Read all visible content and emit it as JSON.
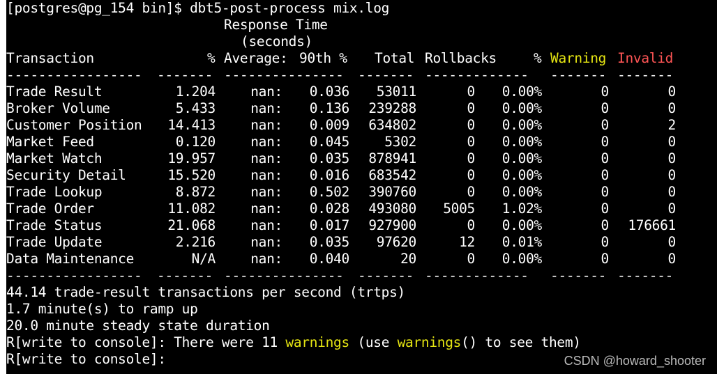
{
  "prompt_command": "[postgres@pg_154 bin]$ dbt5-post-process mix.log",
  "header": {
    "response_time": "Response Time",
    "seconds": "(seconds)",
    "col_transaction": "Transaction",
    "col_pct": "%",
    "col_average": "Average:",
    "col_90th": "90th %",
    "col_total": "Total",
    "col_rollbacks": "Rollbacks",
    "col_rb_pct": "%",
    "col_warning": "Warning",
    "col_invalid": "Invalid"
  },
  "separator": {
    "s1": "-----------------",
    "s2": "-------",
    "s3": "---------------",
    "s4": "-------",
    "s5": "-------------",
    "s6": "-------",
    "s7": "-------"
  },
  "rows": [
    {
      "name": "Trade Result",
      "pct": "1.204",
      "avg": "nan:",
      "p90": "0.036",
      "total": "53011",
      "rollbacks": "0",
      "rb_pct": "0.00%",
      "warning": "0",
      "invalid": "0"
    },
    {
      "name": "Broker Volume",
      "pct": "5.433",
      "avg": "nan:",
      "p90": "0.136",
      "total": "239288",
      "rollbacks": "0",
      "rb_pct": "0.00%",
      "warning": "0",
      "invalid": "0"
    },
    {
      "name": "Customer Position",
      "pct": "14.413",
      "avg": "nan:",
      "p90": "0.009",
      "total": "634802",
      "rollbacks": "0",
      "rb_pct": "0.00%",
      "warning": "0",
      "invalid": "2"
    },
    {
      "name": "Market Feed",
      "pct": "0.120",
      "avg": "nan:",
      "p90": "0.045",
      "total": "5302",
      "rollbacks": "0",
      "rb_pct": "0.00%",
      "warning": "0",
      "invalid": "0"
    },
    {
      "name": "Market Watch",
      "pct": "19.957",
      "avg": "nan:",
      "p90": "0.035",
      "total": "878941",
      "rollbacks": "0",
      "rb_pct": "0.00%",
      "warning": "0",
      "invalid": "0"
    },
    {
      "name": "Security Detail",
      "pct": "15.520",
      "avg": "nan:",
      "p90": "0.016",
      "total": "683542",
      "rollbacks": "0",
      "rb_pct": "0.00%",
      "warning": "0",
      "invalid": "0"
    },
    {
      "name": "Trade Lookup",
      "pct": "8.872",
      "avg": "nan:",
      "p90": "0.502",
      "total": "390760",
      "rollbacks": "0",
      "rb_pct": "0.00%",
      "warning": "0",
      "invalid": "0"
    },
    {
      "name": "Trade Order",
      "pct": "11.082",
      "avg": "nan:",
      "p90": "0.028",
      "total": "493080",
      "rollbacks": "5005",
      "rb_pct": "1.02%",
      "warning": "0",
      "invalid": "0"
    },
    {
      "name": "Trade Status",
      "pct": "21.068",
      "avg": "nan:",
      "p90": "0.017",
      "total": "927900",
      "rollbacks": "0",
      "rb_pct": "0.00%",
      "warning": "0",
      "invalid": "176661"
    },
    {
      "name": "Trade Update",
      "pct": "2.216",
      "avg": "nan:",
      "p90": "0.035",
      "total": "97620",
      "rollbacks": "12",
      "rb_pct": "0.01%",
      "warning": "0",
      "invalid": "0"
    },
    {
      "name": "Data Maintenance",
      "pct": "N/A",
      "avg": "nan:",
      "p90": "0.040",
      "total": "20",
      "rollbacks": "0",
      "rb_pct": "0.00%",
      "warning": "0",
      "invalid": "0"
    }
  ],
  "summary": {
    "trtps": "44.14 trade-result transactions per second (trtps)",
    "ramp": "1.7 minute(s) to ramp up",
    "steady": "20.0 minute steady state duration",
    "console1_prefix": "R[write to console]: There were 11 ",
    "console1_warnings1": "warnings",
    "console1_mid": " (use ",
    "console1_warnings2": "warnings",
    "console1_suffix": "() to see them)",
    "console2": "R[write to console]:"
  },
  "watermark": "CSDN @howard_shooter",
  "colors": {
    "background": "#000000",
    "text": "#ffffff",
    "warning": "#e5e512",
    "invalid": "#ff5555"
  }
}
